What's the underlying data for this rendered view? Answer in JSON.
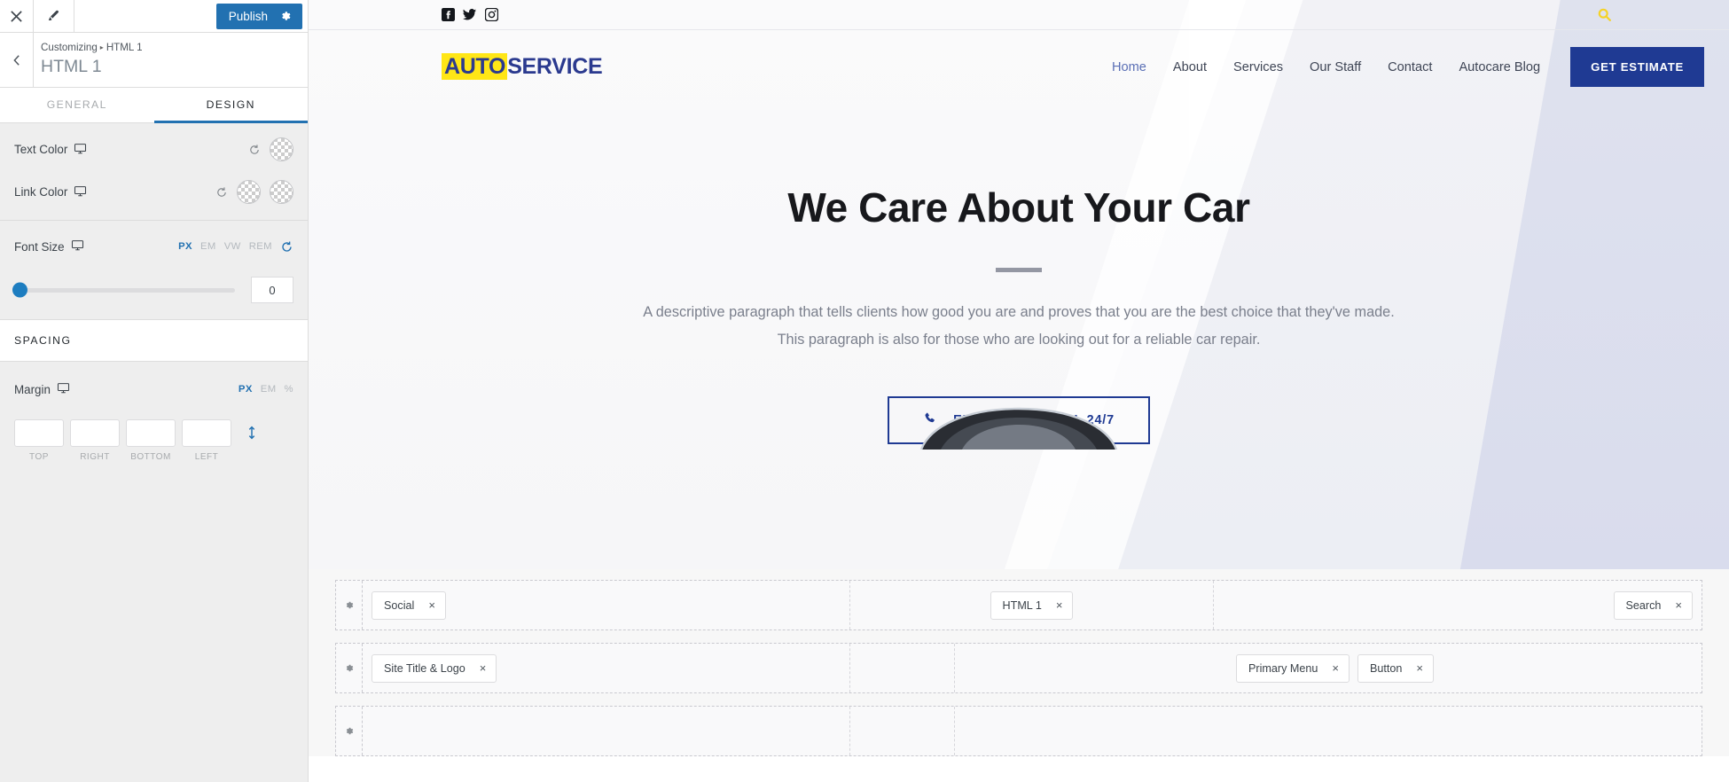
{
  "customizer": {
    "close_icon": "close-icon",
    "brush_icon": "brush-icon",
    "publish_label": "Publish",
    "publish_gear_icon": "gear-icon",
    "back_icon": "chevron-left-icon",
    "breadcrumb_root": "Customizing",
    "breadcrumb_sep": "▸",
    "breadcrumb_current": "HTML 1",
    "panel_title": "HTML 1",
    "tabs": [
      {
        "label": "GENERAL",
        "active": false
      },
      {
        "label": "DESIGN",
        "active": true
      }
    ],
    "controls": {
      "text_color": {
        "label": "Text Color",
        "device_icon": "desktop-icon",
        "reset_icon": "reset-icon",
        "swatches": 1
      },
      "link_color": {
        "label": "Link Color",
        "device_icon": "desktop-icon",
        "reset_icon": "reset-icon",
        "swatches": 2
      },
      "font_size": {
        "label": "Font Size",
        "device_icon": "desktop-icon",
        "units": [
          "PX",
          "EM",
          "VW",
          "REM"
        ],
        "active_unit": "PX",
        "reset_icon": "reset-icon",
        "value": "0",
        "slider_percent": 0
      },
      "spacing_section": "SPACING",
      "margin": {
        "label": "Margin",
        "device_icon": "desktop-icon",
        "units": [
          "PX",
          "EM",
          "%"
        ],
        "active_unit": "PX",
        "fields": [
          {
            "label": "TOP",
            "value": ""
          },
          {
            "label": "RIGHT",
            "value": ""
          },
          {
            "label": "BOTTOM",
            "value": ""
          },
          {
            "label": "LEFT",
            "value": ""
          }
        ],
        "link_icon": "link-values-icon"
      }
    }
  },
  "site": {
    "topbar": {
      "socials": [
        {
          "name": "facebook-icon"
        },
        {
          "name": "twitter-icon"
        },
        {
          "name": "instagram-icon"
        }
      ],
      "search_icon": "search-icon",
      "search_color": "#f5d327"
    },
    "logo": {
      "part1": "AUTO",
      "part2": "SERVICE",
      "highlight": "#ffe616",
      "color": "#2b3a8f"
    },
    "nav": [
      {
        "label": "Home",
        "active": true
      },
      {
        "label": "About",
        "active": false
      },
      {
        "label": "Services",
        "active": false
      },
      {
        "label": "Our Staff",
        "active": false
      },
      {
        "label": "Contact",
        "active": false
      },
      {
        "label": "Autocare Blog",
        "active": false
      }
    ],
    "cta": {
      "label": "GET ESTIMATE",
      "bg": "#1f3a93"
    },
    "hero": {
      "heading": "We Care About Your Car",
      "paragraph": "A descriptive paragraph that tells clients how good you are and proves that you are the best choice that they've made. This paragraph is also for those who are looking out for a reliable car repair.",
      "button_label": "EMERGENCY CALL 24/7",
      "button_icon": "phone-icon",
      "button_color": "#1f3a93"
    }
  },
  "builder": {
    "rows": [
      {
        "gear_icon": "gear-icon",
        "left": [
          {
            "label": "Social",
            "close": "×"
          }
        ],
        "center": [
          {
            "label": "HTML 1",
            "close": "×"
          }
        ],
        "right": [
          {
            "label": "Search",
            "close": "×"
          }
        ]
      },
      {
        "gear_icon": "gear-icon",
        "left": [
          {
            "label": "Site Title & Logo",
            "close": "×"
          }
        ],
        "center": [],
        "right": [
          {
            "label": "Primary Menu",
            "close": "×"
          },
          {
            "label": "Button",
            "close": "×"
          }
        ]
      },
      {
        "gear_icon": "gear-icon",
        "left": [],
        "center": [],
        "right": []
      }
    ]
  }
}
